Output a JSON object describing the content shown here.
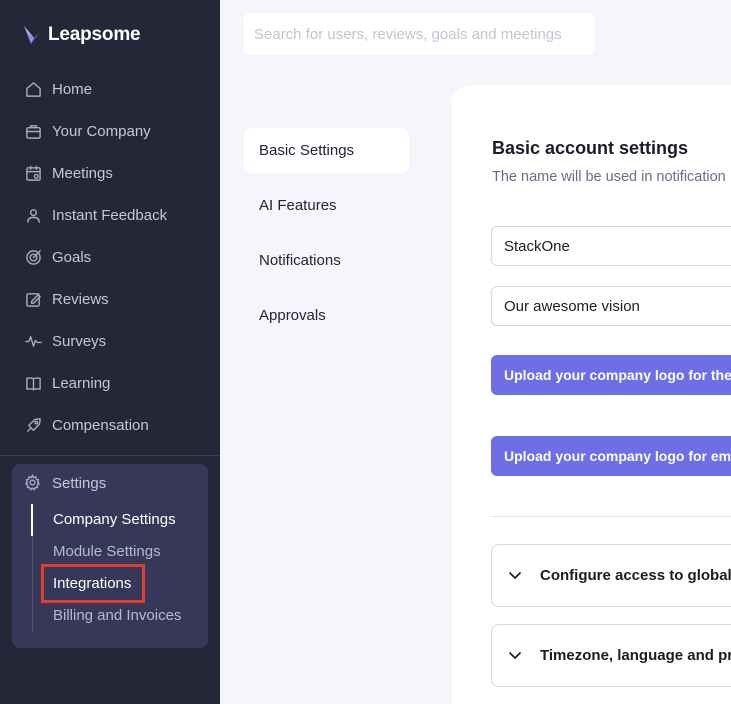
{
  "brand": {
    "name": "Leapsome"
  },
  "sidebar": {
    "items": [
      {
        "label": "Home",
        "icon": "home-icon"
      },
      {
        "label": "Your Company",
        "icon": "company-icon"
      },
      {
        "label": "Meetings",
        "icon": "meetings-icon"
      },
      {
        "label": "Instant Feedback",
        "icon": "feedback-icon"
      },
      {
        "label": "Goals",
        "icon": "goals-icon"
      },
      {
        "label": "Reviews",
        "icon": "reviews-icon"
      },
      {
        "label": "Surveys",
        "icon": "surveys-icon"
      },
      {
        "label": "Learning",
        "icon": "learning-icon"
      },
      {
        "label": "Compensation",
        "icon": "compensation-icon"
      }
    ],
    "settings": {
      "label": "Settings",
      "icon": "gear-icon",
      "subitems": [
        {
          "label": "Company Settings",
          "active": true
        },
        {
          "label": "Module Settings"
        },
        {
          "label": "Integrations",
          "highlighted": true
        },
        {
          "label": "Billing and Invoices"
        }
      ]
    }
  },
  "search": {
    "placeholder": "Search for users, reviews, goals and meetings"
  },
  "settings_menu": {
    "items": [
      {
        "label": "Basic Settings",
        "active": true
      },
      {
        "label": "AI Features"
      },
      {
        "label": "Notifications"
      },
      {
        "label": "Approvals"
      }
    ]
  },
  "main": {
    "title": "Basic account settings",
    "subtitle": "The name will be used in notification",
    "company_name": "StackOne",
    "vision": "Our awesome vision",
    "upload_logo_nav": "Upload your company logo for the na",
    "upload_logo_email": "Upload your company logo for email",
    "accordions": [
      {
        "label": "Configure access to global"
      },
      {
        "label": "Timezone, language and pr"
      }
    ]
  },
  "colors": {
    "sidebar_bg": "#252638",
    "accent": "#6e6ee6",
    "highlight": "#e0402a"
  }
}
